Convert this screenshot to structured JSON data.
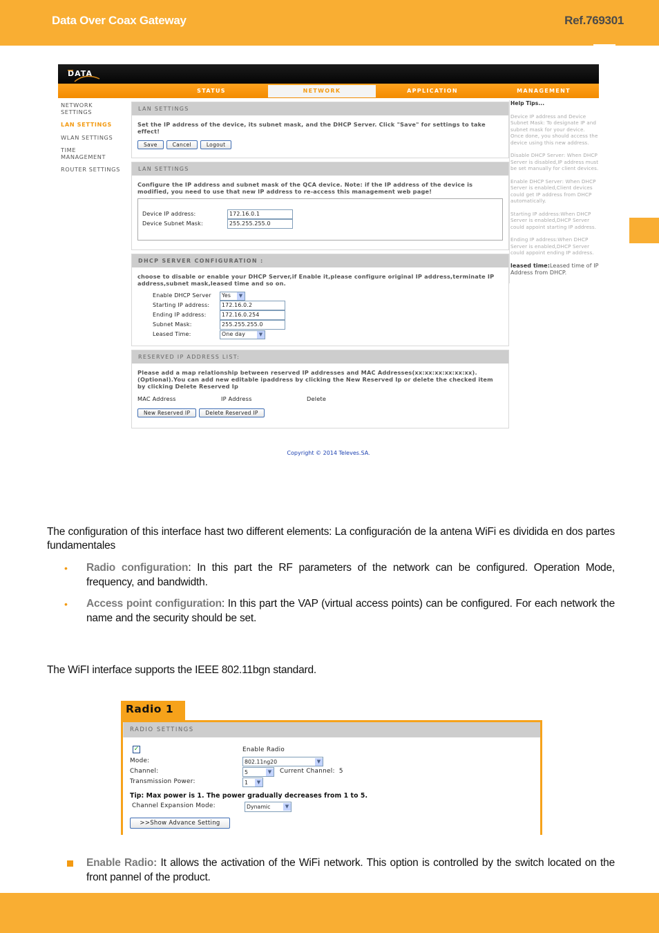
{
  "page": {
    "header_title": "Data Over Coax Gateway",
    "header_ref": "Ref.769301",
    "brand_color": "#f9ae33"
  },
  "webui": {
    "logo_text": "DATA",
    "nav": [
      "STATUS",
      "NETWORK",
      "APPLICATION",
      "MANAGEMENT"
    ],
    "active_nav": "NETWORK",
    "sidebar": [
      {
        "label": "NETWORK SETTINGS"
      },
      {
        "label": "LAN SETTINGS",
        "active": true
      },
      {
        "label": "WLAN SETTINGS"
      },
      {
        "label": "TIME MANAGEMENT"
      },
      {
        "label": "ROUTER SETTINGS"
      }
    ],
    "lan1": {
      "title": "LAN SETTINGS",
      "description": "Set the IP address of the device, its subnet mask, and the DHCP Server. Click \"Save\" for settings to take effect!",
      "buttons": {
        "save": "Save",
        "cancel": "Cancel",
        "logout": "Logout"
      }
    },
    "lan2": {
      "title": "LAN SETTINGS",
      "description": "Configure the IP address and subnet mask of the QCA device. Note: if the IP address of the device is modified, you need to use that new IP address to re-access this management web page!",
      "ip_label": "Device IP address:",
      "ip_value": "172.16.0.1",
      "mask_label": "Device Subnet Mask:",
      "mask_value": "255.255.255.0"
    },
    "dhcp": {
      "title": "DHCP SERVER CONFIGURATION :",
      "description": "choose to disable or enable your DHCP Server,if Enable it,please configure original IP address,terminate IP address,subnet mask,leased time and so on.",
      "enable_label": "Enable DHCP Server",
      "enable_value": "Yes",
      "start_label": "Starting IP address:",
      "start_value": "172.16.0.2",
      "end_label": "Ending IP address:",
      "end_value": "172.16.0.254",
      "mask_label": "Subnet Mask:",
      "mask_value": "255.255.255.0",
      "lease_label": "Leased Time:",
      "lease_value": "One day"
    },
    "reserved": {
      "title": "RESERVED IP ADDRESS LIST:",
      "description": "Please add a map relationship between reserved IP addresses and MAC Addresses(xx:xx:xx:xx:xx:xx).(Optional).You can add new editable ipaddress by clicking the New Reserved Ip or delete the checked item by clicking Delete Reserved Ip",
      "columns": [
        "MAC Address",
        "IP Address",
        "Delete"
      ],
      "new_button": "New Reserved IP",
      "delete_button": "Delete Reserved IP"
    },
    "help": {
      "heading": "Help Tips...",
      "tips": [
        "Device IP address and Device Subnet Mask: To designate IP and subnet mask for your device. Once done, you should access the device using this new address.",
        "Disable DHCP Server: When DHCP Server is disabled,IP address must be set manually for client devices.",
        "Enable DHCP Server: When DHCP Server is enabled,Client devices could get IP address from DHCP automatically.",
        "Starting IP address:When DHCP Server is enabled,DHCP Server could appoint starting IP address.",
        "Ending IP address:When DHCP Server is enabled,DHCP Server could appoint ending IP address."
      ],
      "leased_key": "leased time:",
      "leased_text": "Leased time of IP Address from DHCP."
    },
    "copyright": "Copyright © 2014 Televes.SA."
  },
  "doc": {
    "intro": "The configuration of this interface hast two different elements: La configuración de la antena WiFi es dividida en dos partes fundamentales",
    "bullets": [
      {
        "keyword": "Radio configuration",
        "text": ": In this part the RF parameters of the network can be configured. Operation Mode, frequency, and bandwidth."
      },
      {
        "keyword": "Access point configuration",
        "text": ": In this part the VAP (virtual access points) can be configured. For each network the name and the security should be set."
      }
    ],
    "standard": "The WiFI interface supports  the IEEE 802.11bgn standard.",
    "enable_radio": {
      "keyword": "Enable Radio:",
      "text": " It allows the activation of the WiFi network. This option is controlled by the switch located on the front pannel of the product."
    }
  },
  "radio": {
    "tab": "Radio 1",
    "section_title": "RADIO SETTINGS",
    "enable_checked": true,
    "enable_label": "Enable Radio",
    "mode_label": "Mode:",
    "mode_value": "802.11ng20",
    "channel_label": "Channel:",
    "channel_value": "5",
    "current_channel_label": "Current Channel:",
    "current_channel_value": "5",
    "power_label": "Transmission Power:",
    "power_value": "1",
    "tip": "Tip: Max power is 1. The power gradually decreases from 1 to 5.",
    "expansion_label": "Channel Expansion Mode:",
    "expansion_value": "Dynamic",
    "advance_button": ">>Show Advance Setting"
  }
}
